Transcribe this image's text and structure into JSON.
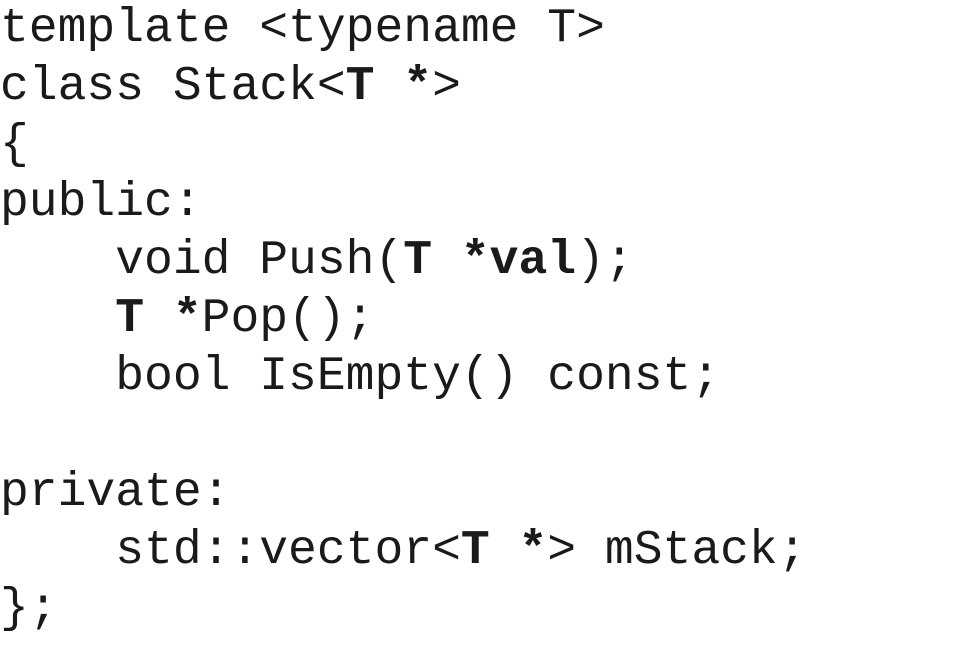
{
  "code": {
    "lines": [
      [
        {
          "t": "template <typename T>",
          "b": false
        }
      ],
      [
        {
          "t": "class Stack<",
          "b": false
        },
        {
          "t": "T *",
          "b": true
        },
        {
          "t": ">",
          "b": false
        }
      ],
      [
        {
          "t": "{",
          "b": false
        }
      ],
      [
        {
          "t": "public:",
          "b": false
        }
      ],
      [
        {
          "t": "    void Push(",
          "b": false
        },
        {
          "t": "T *val",
          "b": true
        },
        {
          "t": ");",
          "b": false
        }
      ],
      [
        {
          "t": "    ",
          "b": false
        },
        {
          "t": "T *",
          "b": true
        },
        {
          "t": "Pop();",
          "b": false
        }
      ],
      [
        {
          "t": "    bool IsEmpty() const;",
          "b": false
        }
      ],
      [
        {
          "t": "",
          "b": false
        }
      ],
      [
        {
          "t": "private:",
          "b": false
        }
      ],
      [
        {
          "t": "    std::vector<",
          "b": false
        },
        {
          "t": "T *",
          "b": true
        },
        {
          "t": "> mStack;",
          "b": false
        }
      ],
      [
        {
          "t": "};",
          "b": false
        }
      ]
    ]
  }
}
